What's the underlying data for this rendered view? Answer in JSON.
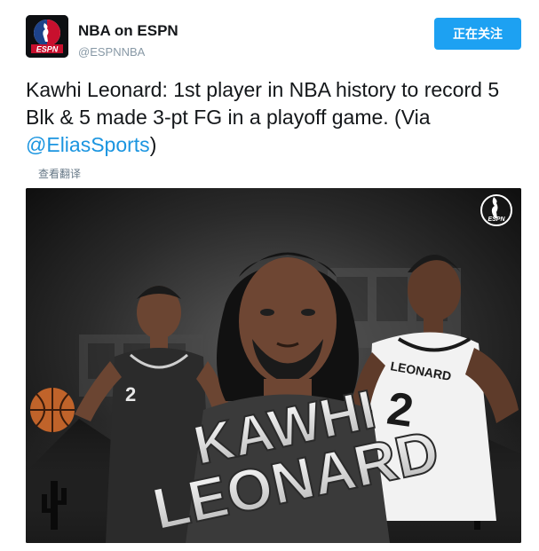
{
  "account": {
    "display_name": "NBA on ESPN",
    "handle": "@ESPNNBA",
    "avatar_logo_text": "ESPN"
  },
  "follow_button": {
    "label": "正在关注"
  },
  "tweet": {
    "text_main": "Kawhi Leonard: 1st player in NBA history to record 5 Blk & 5 made 3-pt FG in a playoff game. (Via ",
    "mention": "@EliasSports",
    "text_end": ")"
  },
  "translate_link": "查看翻译",
  "media": {
    "headline_line1": "KAWHI",
    "headline_line2": "LEONARD",
    "jersey_name": "LEONARD",
    "jersey_number": "2",
    "corner_logo_text": "ESPN",
    "colors": {
      "jersey_dark": "#2b2b2b",
      "jersey_white": "#f2f2f2",
      "skin": "#6b4532",
      "bg_dark": "#161616",
      "bg_mid": "#3a3a3a"
    }
  }
}
